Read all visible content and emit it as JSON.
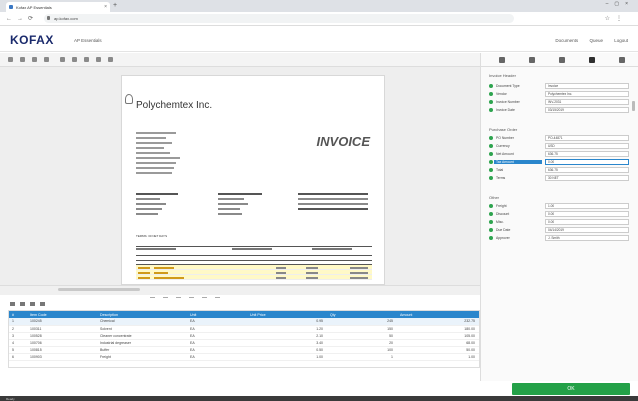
{
  "browser": {
    "tab_title": "Kofax AP Essentials",
    "url": "ap.kofax.com"
  },
  "app": {
    "logo": "KOFAX",
    "name": "AP Essentials",
    "nav": [
      "Documents",
      "Queue",
      "Logout"
    ]
  },
  "invoice": {
    "company": "Polychemtex Inc.",
    "title": "INVOICE",
    "terms": "TERMS: 30 NET DAYS"
  },
  "grid": {
    "headers": [
      "#",
      "Item Code",
      "Description",
      "Unit",
      "Unit Price",
      "Qty",
      "Amount"
    ],
    "rows": [
      [
        "1",
        "100245",
        "Chemical",
        "EA",
        "0.95",
        "245",
        "232.75"
      ],
      [
        "2",
        "100311",
        "Solvent",
        "EA",
        "1.20",
        "150",
        "180.00"
      ],
      [
        "3",
        "100528",
        "Cleaner concentrate",
        "EA",
        "2.10",
        "50",
        "105.00"
      ],
      [
        "4",
        "100706",
        "Industrial degreaser",
        "EA",
        "3.40",
        "20",
        "68.00"
      ],
      [
        "5",
        "100815",
        "Buffer",
        "EA",
        "0.50",
        "100",
        "50.00"
      ],
      [
        "6",
        "100903",
        "Freight",
        "EA",
        "1.00",
        "1",
        "1.00"
      ]
    ]
  },
  "panel": {
    "header": "Invoice Header",
    "fields1": [
      {
        "label": "Document Type",
        "value": "Invoice"
      },
      {
        "label": "Vendor",
        "value": "Polychemtex Inc."
      },
      {
        "label": "Invoice Number",
        "value": "INV-2031"
      },
      {
        "label": "Invoice Date",
        "value": "03/15/2019"
      }
    ],
    "section2": "Purchase Order",
    "fields2": [
      {
        "label": "PO Number",
        "value": "PO-44871"
      },
      {
        "label": "Currency",
        "value": "USD"
      },
      {
        "label": "Net Amount",
        "value": "636.75"
      },
      {
        "label": "Tax Amount",
        "value": "0.00"
      },
      {
        "label": "Total",
        "value": "636.75"
      },
      {
        "label": "Terms",
        "value": "30 NET"
      }
    ],
    "section3": "Other",
    "fields3": [
      {
        "label": "Freight",
        "value": "1.00"
      },
      {
        "label": "Discount",
        "value": "0.00"
      },
      {
        "label": "Misc.",
        "value": "0.00"
      },
      {
        "label": "Due Date",
        "value": "04/14/2019"
      },
      {
        "label": "Approver",
        "value": "J. Smith"
      }
    ]
  },
  "buttons": {
    "ok": "OK"
  },
  "status": "Ready",
  "colors": {
    "accent": "#2a86cc",
    "ok": "#24a148",
    "brand": "#1a2a6c"
  }
}
